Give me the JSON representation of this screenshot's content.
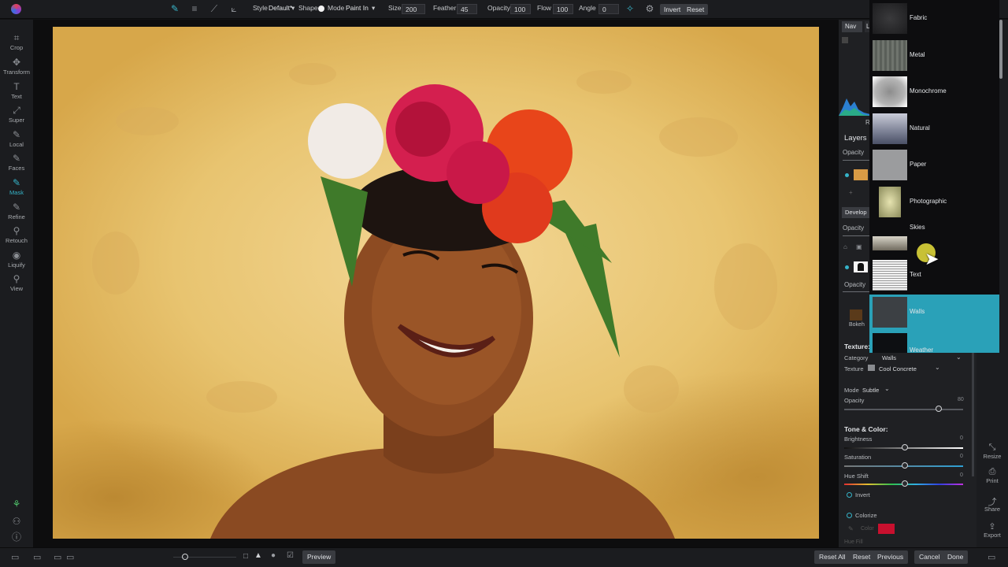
{
  "toolbar": {
    "style_label": "Style",
    "style_value": "Default*",
    "shape_label": "Shape",
    "mode_label": "Mode",
    "mode_value": "Paint In",
    "size_label": "Size",
    "size_value": "200",
    "feather_label": "Feather",
    "feather_value": "45",
    "opacity_label": "Opacity",
    "opacity_value": "100",
    "flow_label": "Flow",
    "flow_value": "100",
    "angle_label": "Angle",
    "angle_value": "0",
    "invert_label": "Invert",
    "reset_label": "Reset"
  },
  "tools": [
    {
      "label": "Crop",
      "icon": "crop-icon"
    },
    {
      "label": "Transform",
      "icon": "transform-icon"
    },
    {
      "label": "Text",
      "icon": "text-icon"
    },
    {
      "label": "Super",
      "icon": "super-icon"
    },
    {
      "label": "Local",
      "icon": "local-icon"
    },
    {
      "label": "Faces",
      "icon": "faces-icon"
    },
    {
      "label": "Mask",
      "icon": "mask-icon"
    },
    {
      "label": "Refine",
      "icon": "refine-icon"
    },
    {
      "label": "Retouch",
      "icon": "retouch-icon"
    },
    {
      "label": "Liquify",
      "icon": "liquify-icon"
    },
    {
      "label": "View",
      "icon": "view-icon"
    }
  ],
  "panel": {
    "nav_tab": "Nav",
    "nav_tab2": "L",
    "hist_letter": "R",
    "layers_title": "Layers",
    "opacity_label": "Opacity",
    "develop_label": "Develop",
    "opacity_label2": "Opacity",
    "opacity_label3": "Opacity",
    "bokeh_label": "Bokeh",
    "texture_heading": "Texture:",
    "category_label": "Category",
    "category_value": "Walls",
    "texture_label": "Texture",
    "texture_value": "Cool Concrete",
    "mode_label": "Mode",
    "mode_value": "Subtle",
    "opacity_slider_label": "Opacity",
    "opacity_slider_value": "80",
    "tone_heading": "Tone & Color:",
    "brightness_label": "Brightness",
    "brightness_value": "0",
    "saturation_label": "Saturation",
    "saturation_value": "0",
    "hue_label": "Hue Shift",
    "hue_value": "0",
    "invert_label": "Invert",
    "colorize_label": "Colorize",
    "color_label": "Color",
    "colorize_swatch": "#c8102e",
    "hue_fill_label": "Hue Fill"
  },
  "dropdown": {
    "items": [
      "Fabric",
      "Metal",
      "Monochrome",
      "Natural",
      "Paper",
      "Photographic",
      "Skies",
      "Text",
      "Walls",
      "Weather"
    ],
    "selected": "Walls"
  },
  "farright": [
    {
      "label": "Resize",
      "icon": "resize-icon"
    },
    {
      "label": "Print",
      "icon": "print-icon"
    },
    {
      "label": "Share",
      "icon": "share-icon"
    },
    {
      "label": "Export",
      "icon": "export-icon"
    }
  ],
  "bottombar": {
    "preview_label": "Preview",
    "reset_all_label": "Reset All",
    "reset_label": "Reset",
    "previous_label": "Previous",
    "cancel_label": "Cancel",
    "done_label": "Done"
  },
  "colors": {
    "accent": "#35b3c8",
    "selected_row": "#2aa1b8"
  }
}
